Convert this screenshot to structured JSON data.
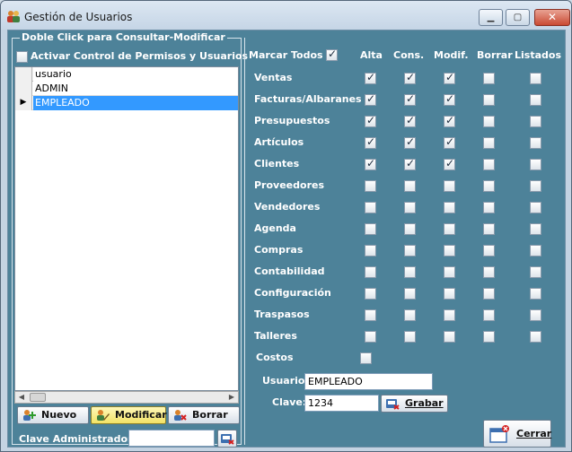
{
  "window": {
    "title": "Gestión de Usuarios"
  },
  "left_panel": {
    "group_title": "Doble Click para Consultar-Modificar",
    "activate_label": "Activar Control de Permisos y Usuarios",
    "activate_checked": false,
    "grid": {
      "header": "usuario",
      "rows": [
        "ADMIN",
        "EMPLEADO"
      ],
      "selected_index": 1
    },
    "buttons": {
      "nuevo": "Nuevo",
      "modificar": "Modificar",
      "borrar": "Borrar"
    },
    "admin_label": "Clave Administrador:",
    "admin_value": ""
  },
  "permissions": {
    "mark_all_label": "Marcar Todos",
    "mark_all_checked": true,
    "columns": [
      "Alta",
      "Cons.",
      "Modif.",
      "Borrar",
      "Listados"
    ],
    "modules": [
      {
        "name": "Ventas",
        "checks": [
          true,
          true,
          true,
          false,
          false
        ]
      },
      {
        "name": "Facturas/Albaranes",
        "checks": [
          true,
          true,
          true,
          false,
          false
        ]
      },
      {
        "name": "Presupuestos",
        "checks": [
          true,
          true,
          true,
          false,
          false
        ]
      },
      {
        "name": "Artículos",
        "checks": [
          true,
          true,
          true,
          false,
          false
        ]
      },
      {
        "name": "Clientes",
        "checks": [
          true,
          true,
          true,
          false,
          false
        ]
      },
      {
        "name": "Proveedores",
        "checks": [
          false,
          false,
          false,
          false,
          false
        ]
      },
      {
        "name": "Vendedores",
        "checks": [
          false,
          false,
          false,
          false,
          false
        ]
      },
      {
        "name": "Agenda",
        "checks": [
          false,
          false,
          false,
          false,
          false
        ]
      },
      {
        "name": "Compras",
        "checks": [
          false,
          false,
          false,
          false,
          false
        ]
      },
      {
        "name": "Contabilidad",
        "checks": [
          false,
          false,
          false,
          false,
          false
        ]
      },
      {
        "name": "Configuración",
        "checks": [
          false,
          false,
          false,
          false,
          false
        ]
      },
      {
        "name": "Traspasos",
        "checks": [
          false,
          false,
          false,
          false,
          false
        ]
      },
      {
        "name": "Talleres",
        "checks": [
          false,
          false,
          false,
          false,
          false
        ]
      },
      {
        "name": "Costos",
        "checks": [
          false
        ]
      }
    ]
  },
  "form": {
    "usuario_label": "Usuario:",
    "usuario_value": "EMPLEADO",
    "clave_label": "Clave:",
    "clave_value": "1234",
    "grabar_label": "Grabar",
    "cerrar_label": "Cerrar"
  },
  "icons": {
    "app": "users-icon",
    "nuevo": "add-user-icon",
    "modificar": "edit-user-icon",
    "borrar": "delete-user-icon",
    "grabar": "save-key-icon",
    "admin": "key-icon",
    "cerrar": "close-window-icon"
  }
}
